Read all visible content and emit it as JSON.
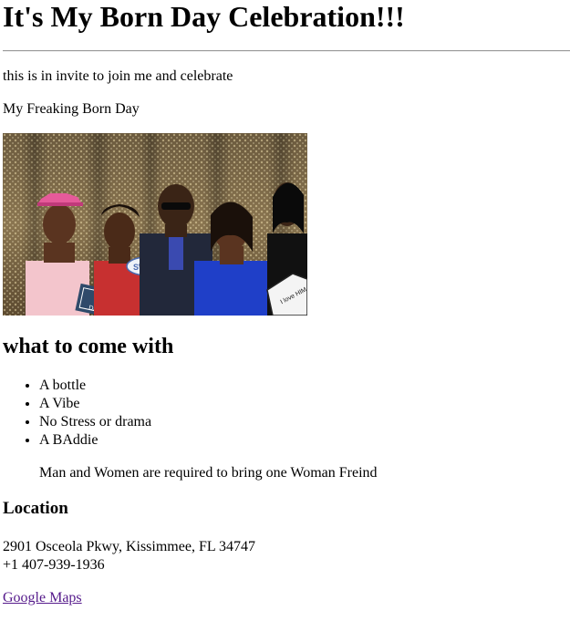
{
  "header": {
    "title": "It's My Born Day Celebration!!!"
  },
  "intro": {
    "invite_text": "this is in invite to join me and celebrate",
    "tagline": "My Freaking Born Day"
  },
  "photo": {
    "description_icon": "party-photo",
    "prop_sign_left": "YOU DID IT",
    "prop_sign_middle": "SWEET",
    "prop_sign_right": "I love HIM"
  },
  "bring": {
    "title": "what to come with",
    "items": [
      "A bottle",
      "A Vibe",
      "No Stress or drama",
      "A BAddie"
    ],
    "note": "Man and Women are required to bring one Woman Freind"
  },
  "location": {
    "title": "Location",
    "address": "2901 Osceola Pkwy, Kissimmee, FL 34747",
    "phone": "+1 407-939-1936",
    "maps_link": "Google Maps"
  },
  "colors": {
    "link_visited": "#551a8b",
    "text": "#000000",
    "background": "#ffffff"
  }
}
